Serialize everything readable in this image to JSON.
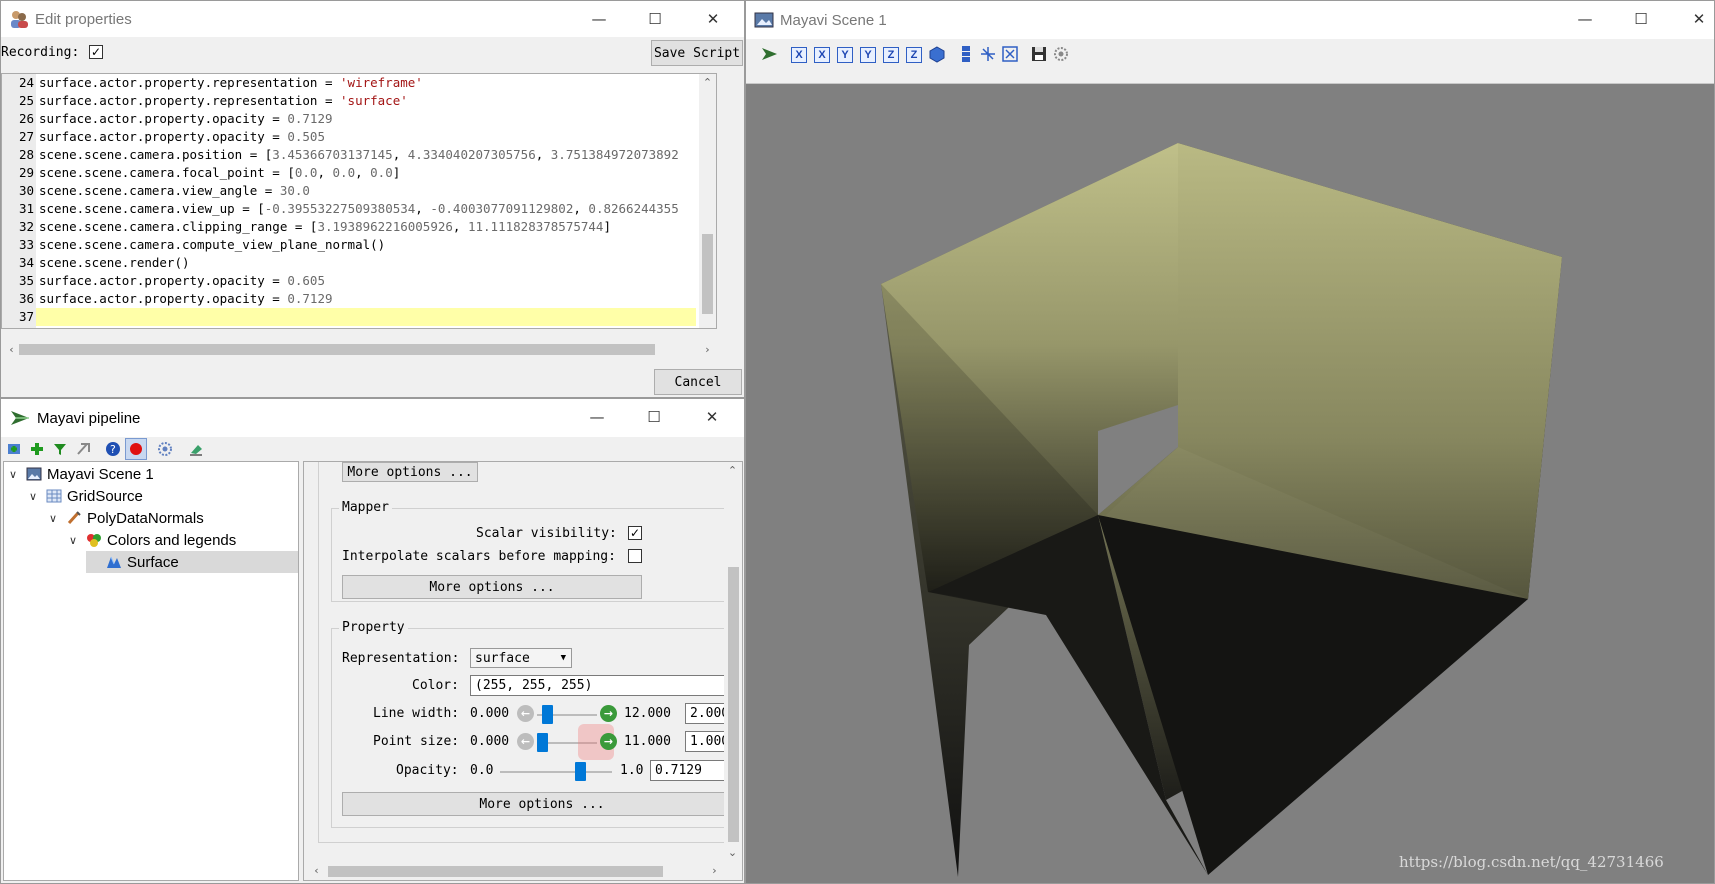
{
  "edit_window": {
    "title": "Edit properties",
    "recording_label": "Recording:",
    "recording_checked": true,
    "save_script_label": "Save Script",
    "cancel_label": "Cancel",
    "lines": [
      {
        "n": "24",
        "segments": [
          {
            "t": "surface.actor.property.representation = ",
            "c": "plain"
          },
          {
            "t": "'wireframe'",
            "c": "str"
          }
        ]
      },
      {
        "n": "25",
        "segments": [
          {
            "t": "surface.actor.property.representation = ",
            "c": "plain"
          },
          {
            "t": "'surface'",
            "c": "str"
          }
        ]
      },
      {
        "n": "26",
        "segments": [
          {
            "t": "surface.actor.property.opacity = ",
            "c": "plain"
          },
          {
            "t": "0.7129",
            "c": "num"
          }
        ]
      },
      {
        "n": "27",
        "segments": [
          {
            "t": "surface.actor.property.opacity = ",
            "c": "plain"
          },
          {
            "t": "0.505",
            "c": "num"
          }
        ]
      },
      {
        "n": "28",
        "segments": [
          {
            "t": "scene.scene.camera.position = [",
            "c": "plain"
          },
          {
            "t": "3.45366703137145",
            "c": "num"
          },
          {
            "t": ", ",
            "c": "plain"
          },
          {
            "t": "4.334040207305756",
            "c": "num"
          },
          {
            "t": ", ",
            "c": "plain"
          },
          {
            "t": "3.751384972073892",
            "c": "num"
          }
        ]
      },
      {
        "n": "29",
        "segments": [
          {
            "t": "scene.scene.camera.focal_point = [",
            "c": "plain"
          },
          {
            "t": "0.0",
            "c": "num"
          },
          {
            "t": ", ",
            "c": "plain"
          },
          {
            "t": "0.0",
            "c": "num"
          },
          {
            "t": ", ",
            "c": "plain"
          },
          {
            "t": "0.0",
            "c": "num"
          },
          {
            "t": "]",
            "c": "plain"
          }
        ]
      },
      {
        "n": "30",
        "segments": [
          {
            "t": "scene.scene.camera.view_angle = ",
            "c": "plain"
          },
          {
            "t": "30.0",
            "c": "num"
          }
        ]
      },
      {
        "n": "31",
        "segments": [
          {
            "t": "scene.scene.camera.view_up = [",
            "c": "plain"
          },
          {
            "t": "-0.39553227509380534",
            "c": "num"
          },
          {
            "t": ", ",
            "c": "plain"
          },
          {
            "t": "-0.4003077091129802",
            "c": "num"
          },
          {
            "t": ", ",
            "c": "plain"
          },
          {
            "t": "0.8266244355",
            "c": "num"
          }
        ]
      },
      {
        "n": "32",
        "segments": [
          {
            "t": "scene.scene.camera.clipping_range = [",
            "c": "plain"
          },
          {
            "t": "3.1938962216005926",
            "c": "num"
          },
          {
            "t": ", ",
            "c": "plain"
          },
          {
            "t": "11.111828378575744",
            "c": "num"
          },
          {
            "t": "]",
            "c": "plain"
          }
        ]
      },
      {
        "n": "33",
        "segments": [
          {
            "t": "scene.scene.camera.compute_view_plane_normal()",
            "c": "plain"
          }
        ]
      },
      {
        "n": "34",
        "segments": [
          {
            "t": "scene.scene.render()",
            "c": "plain"
          }
        ]
      },
      {
        "n": "35",
        "segments": [
          {
            "t": "surface.actor.property.opacity = ",
            "c": "plain"
          },
          {
            "t": "0.605",
            "c": "num"
          }
        ]
      },
      {
        "n": "36",
        "segments": [
          {
            "t": "surface.actor.property.opacity = ",
            "c": "plain"
          },
          {
            "t": "0.7129",
            "c": "num"
          }
        ]
      },
      {
        "n": "37",
        "segments": [
          {
            "t": "",
            "c": "plain"
          }
        ]
      }
    ]
  },
  "pipeline_window": {
    "title": "Mayavi pipeline",
    "tree": [
      {
        "label": "Mayavi Scene 1",
        "icon": "scene-icon"
      },
      {
        "label": "GridSource",
        "icon": "grid-icon"
      },
      {
        "label": "PolyDataNormals",
        "icon": "filter-icon"
      },
      {
        "label": "Colors and legends",
        "icon": "colors-icon"
      },
      {
        "label": "Surface",
        "icon": "surface-icon",
        "selected": true
      }
    ],
    "more_options_label": "More options ...",
    "mapper": {
      "title": "Mapper",
      "scalar_visibility_label": "Scalar visibility:",
      "scalar_visibility_checked": true,
      "interpolate_label": "Interpolate scalars before mapping:",
      "interpolate_checked": false
    },
    "property": {
      "title": "Property",
      "representation_label": "Representation:",
      "representation_value": "surface",
      "color_label": "Color:",
      "color_value": "(255, 255, 255)",
      "line_width": {
        "label": "Line width:",
        "min": "0.000",
        "max": "12.000",
        "value": "2.000",
        "fraction": 0.17
      },
      "point_size": {
        "label": "Point size:",
        "min": "0.000",
        "max": "11.000",
        "value": "1.000",
        "fraction": 0.09
      },
      "opacity": {
        "label": "Opacity:",
        "min": "0.0",
        "max": "1.0",
        "value": "0.7129",
        "fraction": 0.7129
      }
    }
  },
  "scene_window": {
    "title": "Mayavi Scene 1",
    "toolbar": [
      "-X",
      "+X",
      "-Y",
      "+Y",
      "-Z",
      "+Z"
    ],
    "watermark": "https://blog.csdn.net/qq_42731466",
    "colors": {
      "background": "#808080",
      "cube_top": "#c8c88e",
      "cube_dark": "#1a1a14"
    }
  }
}
